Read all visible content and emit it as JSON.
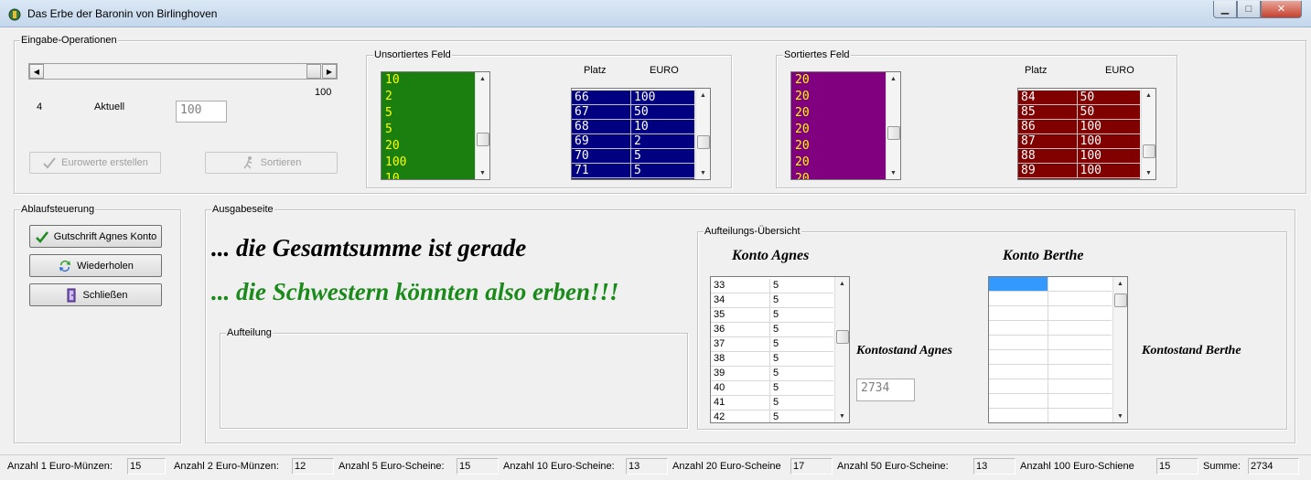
{
  "window": {
    "title": "Das Erbe der Baronin von Birlinghoven",
    "min_label": "▁",
    "max_label": "□",
    "close_label": "✕"
  },
  "eingabe": {
    "group_title": "Eingabe-Operationen",
    "scroll_min": "4",
    "scroll_max": "100",
    "aktuell_label": "Aktuell",
    "aktuell_value": "100",
    "btn_eurowerte": "Eurowerte erstellen",
    "btn_sortieren": "Sortieren"
  },
  "unsortiert": {
    "group_title": "Unsortiertes Feld",
    "list": [
      "10",
      "2",
      "5",
      "5",
      "20",
      "100",
      "10"
    ],
    "list_bg": "#1a7f0e",
    "list_fg": "#ffff00",
    "header_platz": "Platz",
    "header_euro": "EURO",
    "grid_bg": "#000080",
    "grid": [
      [
        "66",
        "100"
      ],
      [
        "67",
        "50"
      ],
      [
        "68",
        "10"
      ],
      [
        "69",
        "2"
      ],
      [
        "70",
        "5"
      ],
      [
        "71",
        "5"
      ]
    ]
  },
  "sortiert": {
    "group_title": "Sortiertes Feld",
    "list": [
      "20",
      "20",
      "20",
      "20",
      "20",
      "20",
      "20"
    ],
    "list_bg": "#800080",
    "list_fg": "#ffff00",
    "header_platz": "Platz",
    "header_euro": "EURO",
    "grid_bg": "#800000",
    "grid": [
      [
        "84",
        "50"
      ],
      [
        "85",
        "50"
      ],
      [
        "86",
        "100"
      ],
      [
        "87",
        "100"
      ],
      [
        "88",
        "100"
      ],
      [
        "89",
        "100"
      ]
    ]
  },
  "ablauf": {
    "group_title": "Ablaufsteuerung",
    "btn_gutschrift": "Gutschrift Agnes Konto",
    "btn_wiederholen": "Wiederholen",
    "btn_schliessen": "Schließen"
  },
  "ausgabe": {
    "group_title": "Ausgabeseite",
    "line1": "... die Gesamtsumme ist gerade",
    "line2": "... die Schwestern könnten also erben!!!",
    "line2_color": "#1a8a1a",
    "aufteilung_title": "Aufteilung"
  },
  "uebersicht": {
    "group_title": "Aufteilungs-Übersicht",
    "konto_agnes": "Konto Agnes",
    "konto_berthe": "Konto Berthe",
    "agnes_rows": [
      [
        "33",
        "5"
      ],
      [
        "34",
        "5"
      ],
      [
        "35",
        "5"
      ],
      [
        "36",
        "5"
      ],
      [
        "37",
        "5"
      ],
      [
        "38",
        "5"
      ],
      [
        "39",
        "5"
      ],
      [
        "40",
        "5"
      ],
      [
        "41",
        "5"
      ],
      [
        "42",
        "5"
      ]
    ],
    "kontostand_agnes_label": "Kontostand Agnes",
    "kontostand_agnes_value": "2734",
    "kontostand_berthe_label": "Kontostand Berthe"
  },
  "status": {
    "items": [
      {
        "label": "Anzahl 1 Euro-Münzen:",
        "value": "15"
      },
      {
        "label": "Anzahl 2 Euro-Münzen:",
        "value": "12"
      },
      {
        "label": "Anzahl 5 Euro-Scheine:",
        "value": "15"
      },
      {
        "label": "Anzahl 10 Euro-Scheine:",
        "value": "13"
      },
      {
        "label": "Anzahl 20 Euro-Scheine",
        "value": "17"
      },
      {
        "label": "Anzahl 50 Euro-Scheine:",
        "value": "13"
      },
      {
        "label": "Anzahl 100 Euro-Schiene",
        "value": "15"
      },
      {
        "label": "Summe:",
        "value": "2734"
      }
    ]
  }
}
